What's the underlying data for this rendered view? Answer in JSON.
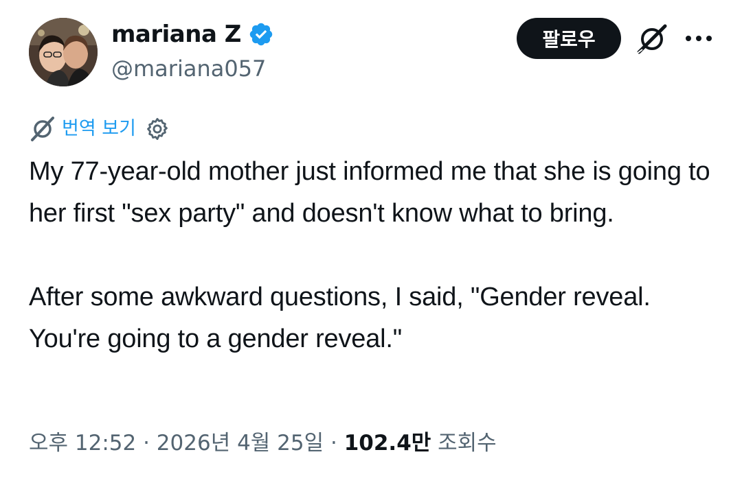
{
  "author": {
    "display_name": "mariana Z",
    "handle": "@mariana057",
    "verified": true
  },
  "actions": {
    "follow_label": "팔로우",
    "grok_icon": "grok-icon",
    "more_icon": "more-icon"
  },
  "translate": {
    "label": "번역 보기",
    "settings_icon": "gear-icon"
  },
  "tweet": {
    "paragraphs": [
      "My 77-year-old mother just informed me that she is going to her first \"sex party\" and doesn't know what to bring.",
      "After some awkward questions, I said, \"Gender reveal. You're going to a gender reveal.\""
    ]
  },
  "meta": {
    "time": "오후 12:52",
    "separator1": " · ",
    "date": "2026년 4월 25일",
    "separator2": " · ",
    "views_count": "102.4만",
    "views_label": " 조회수"
  },
  "colors": {
    "text": "#0f1419",
    "secondary": "#536471",
    "accent": "#1d9bf0",
    "follow_bg": "#0f1419"
  }
}
